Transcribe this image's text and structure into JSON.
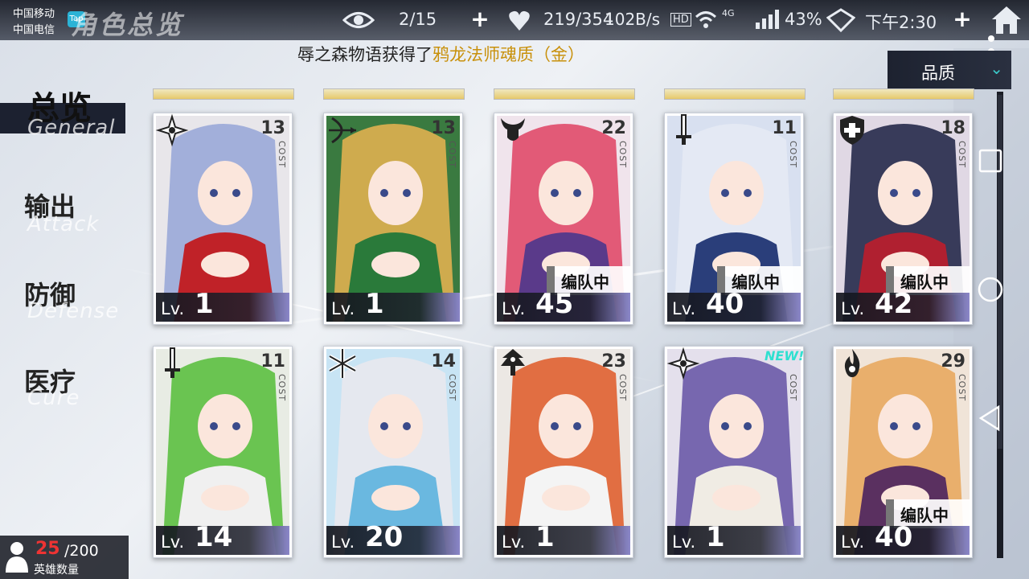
{
  "status_bar": {
    "carrier_1": "中国移动",
    "carrier_2": "中国电信",
    "tap_badge": "Tap",
    "network_speed": "102B/s",
    "hd": "HD",
    "signal": "4G",
    "battery": "43%",
    "time": "下午2:30"
  },
  "screen_title": "角色总览",
  "resources": {
    "view_count": "2/15",
    "stamina": "219/354"
  },
  "ticker": {
    "prefix": "辱之森物语获得了",
    "highlight": "鸦龙法师魂质（金）"
  },
  "quality_filter": {
    "label": "品质",
    "chevron_icon": "chevron-down-icon"
  },
  "nav": {
    "items": [
      {
        "cn": "总览",
        "en": "General",
        "active": true
      },
      {
        "cn": "输出",
        "en": "Attack",
        "active": false
      },
      {
        "cn": "防御",
        "en": "Defense",
        "active": false
      },
      {
        "cn": "医疗",
        "en": "Cure",
        "active": false
      }
    ]
  },
  "hero_count": {
    "current": "25",
    "max": "/200",
    "label": "英雄数量"
  },
  "labels": {
    "lv_prefix": "Lv.",
    "cost_label": "COST",
    "in_team": "编队中",
    "new_badge": "NEW!"
  },
  "cards": [
    {
      "cost": "13",
      "level": "1",
      "class_icon": "shuriken-icon",
      "in_team": false,
      "new": false,
      "hair": "#9aa8d8",
      "cloth": "#c02228",
      "bg": "#e8e6ea"
    },
    {
      "cost": "13",
      "level": "1",
      "class_icon": "bow-icon",
      "in_team": false,
      "new": false,
      "hair": "#e0b050",
      "cloth": "#2a7a3a",
      "bg": "#3a7a40"
    },
    {
      "cost": "22",
      "level": "45",
      "class_icon": "horned-helmet-icon",
      "in_team": true,
      "new": false,
      "hair": "#e04a6a",
      "cloth": "#5a3a8a",
      "bg": "#f0e4ec"
    },
    {
      "cost": "11",
      "level": "40",
      "class_icon": "sword-icon",
      "in_team": true,
      "new": false,
      "hair": "#e6eaf4",
      "cloth": "#2a3e7a",
      "bg": "#d8e0f0"
    },
    {
      "cost": "18",
      "level": "42",
      "class_icon": "shield-icon",
      "in_team": true,
      "new": false,
      "hair": "#262a4a",
      "cloth": "#b02030",
      "bg": "#e0d8e4"
    },
    {
      "cost": "11",
      "level": "14",
      "class_icon": "sword-icon",
      "in_team": false,
      "new": false,
      "hair": "#5cc040",
      "cloth": "#f0f0f0",
      "bg": "#e8ece4"
    },
    {
      "cost": "14",
      "level": "20",
      "class_icon": "snowflake-icon",
      "in_team": false,
      "new": false,
      "hair": "#e8e8ee",
      "cloth": "#6ab8e0",
      "bg": "#c8e4f4"
    },
    {
      "cost": "23",
      "level": "1",
      "class_icon": "tree-emblem-icon",
      "in_team": false,
      "new": false,
      "hair": "#e06030",
      "cloth": "#f4f4f4",
      "bg": "#ece8e4"
    },
    {
      "cost": "",
      "level": "1",
      "class_icon": "shuriken-icon",
      "in_team": false,
      "new": true,
      "hair": "#6a5aa8",
      "cloth": "#f0ece4",
      "bg": "#e4e0ec"
    },
    {
      "cost": "29",
      "level": "40",
      "class_icon": "flame-icon",
      "in_team": true,
      "new": false,
      "hair": "#e8a860",
      "cloth": "#5a3060",
      "bg": "#f0e4d8"
    }
  ]
}
